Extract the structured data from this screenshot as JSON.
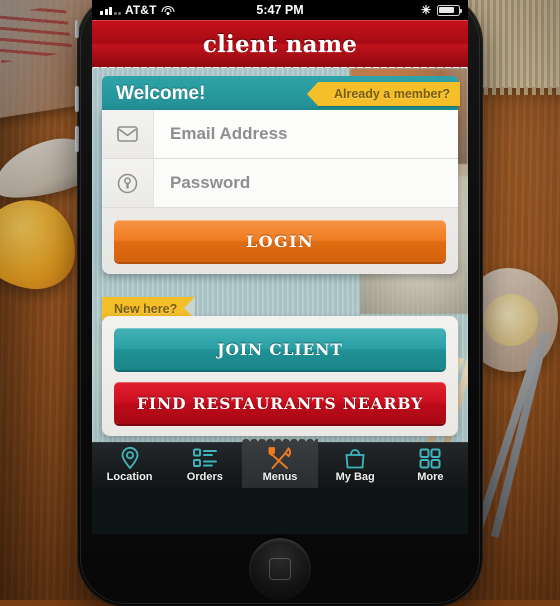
{
  "status_bar": {
    "carrier": "AT&T",
    "time": "5:47 PM",
    "signal_icon": "signal-bars-icon",
    "wifi_icon": "wifi-icon",
    "bluetooth_icon": "bluetooth-icon",
    "bluetooth_glyph": "✳",
    "battery_icon": "battery-icon"
  },
  "header": {
    "title": "client name"
  },
  "welcome": {
    "title": "Welcome!",
    "member_ribbon": "Already a member?"
  },
  "login_form": {
    "email": {
      "placeholder": "Email Address",
      "icon": "envelope-icon"
    },
    "password": {
      "placeholder": "Password",
      "icon": "keyhole-icon"
    },
    "login_button": "LOGIN"
  },
  "signup": {
    "new_ribbon": "New here?",
    "join_button": "JOIN CLIENT",
    "find_button": "FIND RESTAURANTS NEARBY"
  },
  "tabbar": {
    "items": [
      {
        "label": "Location",
        "icon": "map-pin-icon",
        "active": false
      },
      {
        "label": "Orders",
        "icon": "list-icon",
        "active": false
      },
      {
        "label": "Menus",
        "icon": "fork-knife-icon",
        "active": true
      },
      {
        "label": "My Bag",
        "icon": "shopping-bag-icon",
        "active": false
      },
      {
        "label": "More",
        "icon": "grid-icon",
        "active": false
      }
    ]
  },
  "colors": {
    "header_red": "#a60b14",
    "teal": "#2aa0a5",
    "orange": "#ef7c22",
    "yellow_ribbon": "#f5bf29",
    "red_button": "#cc101f",
    "tab_icon_teal": "#3fb6bb",
    "tab_active_orange": "#f07c1e"
  }
}
